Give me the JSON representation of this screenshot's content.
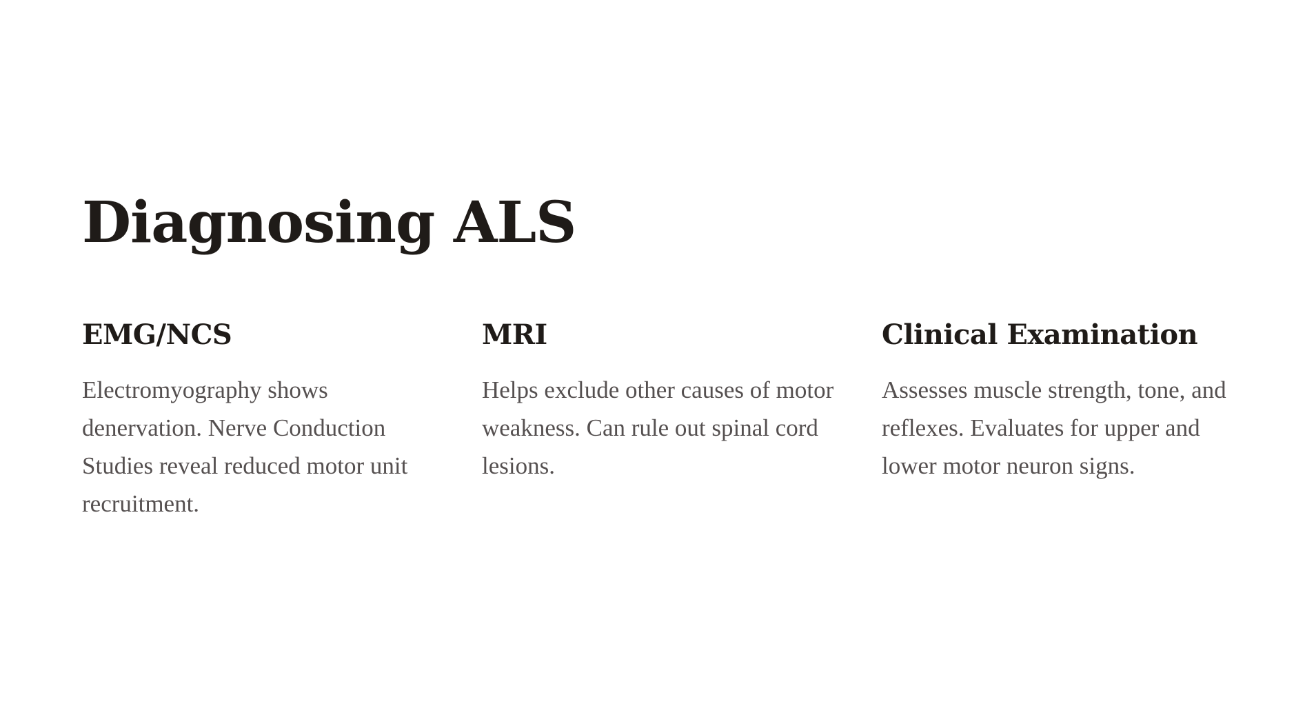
{
  "title": "Diagnosing ALS",
  "columns": [
    {
      "heading": "EMG/NCS",
      "body": "Electromyography shows denervation. Nerve Conduction Studies reveal reduced motor unit recruitment."
    },
    {
      "heading": "MRI",
      "body": "Helps exclude other causes of motor weakness. Can rule out spinal cord lesions."
    },
    {
      "heading": "Clinical Examination",
      "body": "Assesses muscle strength, tone, and reflexes. Evaluates for upper and lower motor neuron signs."
    }
  ],
  "colors": {
    "heading": "#1f1b18",
    "body": "#555050",
    "background": "#ffffff"
  }
}
